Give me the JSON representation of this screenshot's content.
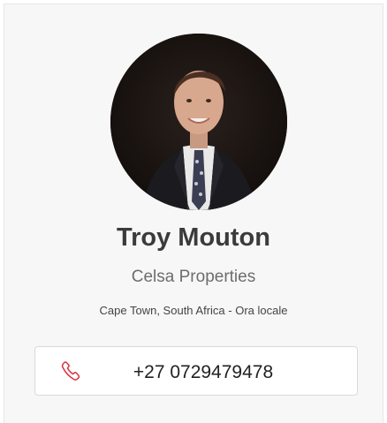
{
  "agent": {
    "name": "Troy Mouton",
    "company": "Celsa Properties",
    "location": "Cape Town, South Africa - Ora locale",
    "phone": "+27 0729479478"
  },
  "colors": {
    "card_background": "#f7f7f7",
    "phone_icon": "#d9363e",
    "name_text": "#3b3b3b"
  },
  "icons": {
    "phone": "phone-icon"
  }
}
